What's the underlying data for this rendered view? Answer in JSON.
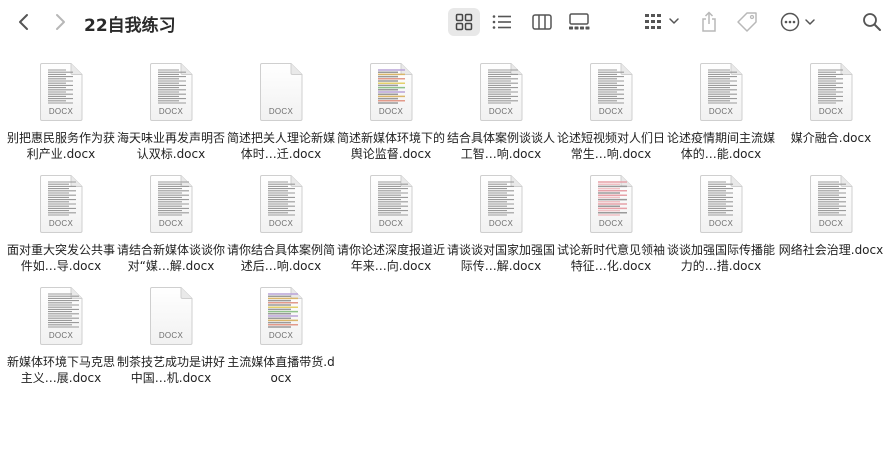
{
  "window": {
    "title": "22自我练习"
  },
  "toolbar": {
    "back_icon": "chevron-left-icon",
    "forward_icon": "chevron-right-icon",
    "view_icons": [
      "icon-view-icon",
      "list-view-icon",
      "column-view-icon",
      "gallery-view-icon"
    ],
    "group_icon": "group-by-icon",
    "share_icon": "share-icon",
    "tag_icon": "tag-icon",
    "more_icon": "ellipsis-circle-icon",
    "search_icon": "magnifier-icon"
  },
  "file_badge": "DOCX",
  "files": [
    {
      "name": "别把惠民服务作为获利产业.docx",
      "thumb": "text"
    },
    {
      "name": "海天味业再发声明否认双标.docx",
      "thumb": "text"
    },
    {
      "name": "简述把关人理论新媒体时…迁.docx",
      "thumb": "blank"
    },
    {
      "name": "简述新媒体环境下的舆论监督.docx",
      "thumb": "color"
    },
    {
      "name": "结合具体案例谈谈人工智…响.docx",
      "thumb": "text"
    },
    {
      "name": "论述短视频对人们日常生…响.docx",
      "thumb": "text"
    },
    {
      "name": "论述疫情期间主流媒体的…能.docx",
      "thumb": "text"
    },
    {
      "name": "媒介融合.docx",
      "thumb": "text"
    },
    {
      "name": "面对重大突发公共事件如…导.docx",
      "thumb": "text"
    },
    {
      "name": "请结合新媒体谈谈你对“媒…解.docx",
      "thumb": "text"
    },
    {
      "name": "请你结合具体案例简述后…响.docx",
      "thumb": "text"
    },
    {
      "name": "请你论述深度报道近年来…向.docx",
      "thumb": "text"
    },
    {
      "name": "请谈谈对国家加强国际传…解.docx",
      "thumb": "text"
    },
    {
      "name": "试论新时代意见领袖特征…化.docx",
      "thumb": "pink"
    },
    {
      "name": "谈谈加强国际传播能力的…措.docx",
      "thumb": "text"
    },
    {
      "name": "网络社会治理.docx",
      "thumb": "text"
    },
    {
      "name": "新媒体环境下马克思主义…展.docx",
      "thumb": "text"
    },
    {
      "name": "制茶技艺成功是讲好中国…机.docx",
      "thumb": "blank"
    },
    {
      "name": "主流媒体直播带货.docx",
      "thumb": "color"
    }
  ]
}
